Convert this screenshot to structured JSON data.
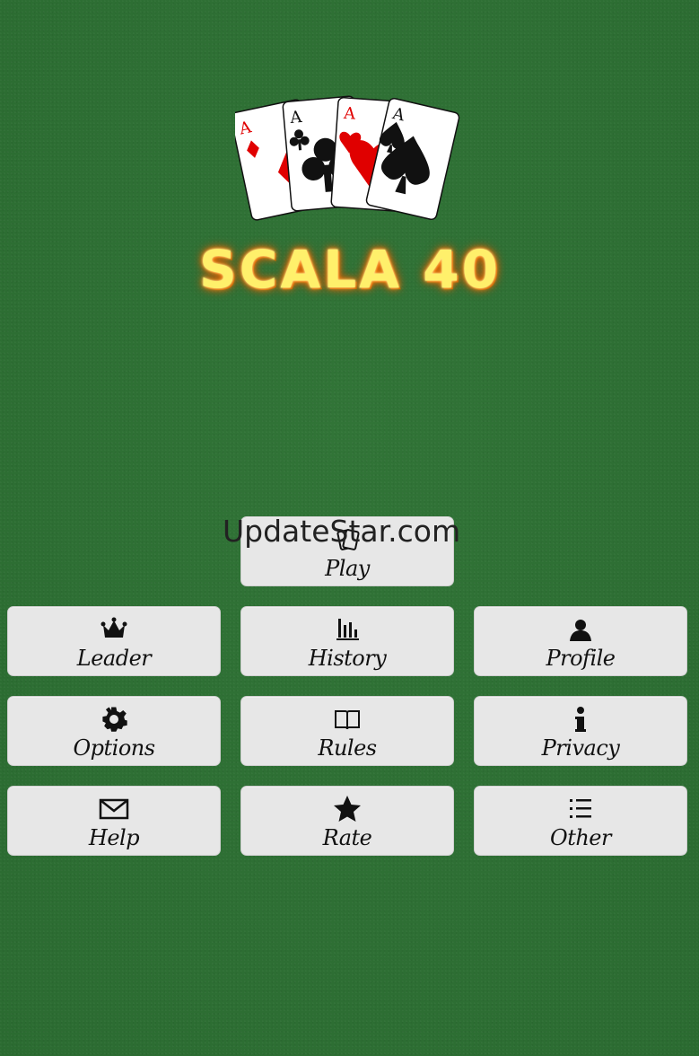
{
  "app": {
    "title": "SCALA 40",
    "watermark": "UpdateStar.com"
  },
  "logo": {
    "cards": [
      {
        "rank": "A",
        "suit": "diamond"
      },
      {
        "rank": "A",
        "suit": "club"
      },
      {
        "rank": "A",
        "suit": "heart"
      },
      {
        "rank": "A",
        "suit": "spade"
      }
    ]
  },
  "menu": {
    "play": {
      "label": "Play",
      "icon": "cards-icon"
    },
    "leader": {
      "label": "Leader",
      "icon": "crown-icon"
    },
    "history": {
      "label": "History",
      "icon": "bar-chart-icon"
    },
    "profile": {
      "label": "Profile",
      "icon": "user-icon"
    },
    "options": {
      "label": "Options",
      "icon": "gear-icon"
    },
    "rules": {
      "label": "Rules",
      "icon": "book-icon"
    },
    "privacy": {
      "label": "Privacy",
      "icon": "info-icon"
    },
    "help": {
      "label": "Help",
      "icon": "envelope-icon"
    },
    "rate": {
      "label": "Rate",
      "icon": "star-icon"
    },
    "other": {
      "label": "Other",
      "icon": "list-icon"
    }
  },
  "colors": {
    "background": "#2d6e34",
    "button": "#e7e7e7",
    "title_glow": "#ff8a00",
    "card_red": "#e00000"
  }
}
